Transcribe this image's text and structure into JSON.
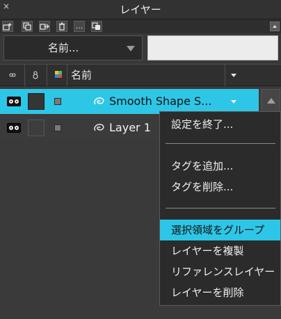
{
  "panel": {
    "title": "レイヤー"
  },
  "toolbar": {
    "buttons": [
      "new-layer-icon",
      "duplicate-icon",
      "export-icon",
      "trash-icon",
      "more-icon",
      "merge-icon"
    ],
    "more_label": "..."
  },
  "filter": {
    "sort_label": "名前...",
    "search_value": "",
    "search_placeholder": ""
  },
  "columns": {
    "name": "名前"
  },
  "layers": [
    {
      "name": "Smooth Shape S...",
      "selected": true
    },
    {
      "name": "Layer 1",
      "selected": false
    }
  ],
  "context_menu": {
    "items": [
      {
        "label": "設定を終了..."
      },
      {
        "label": "タグを追加..."
      },
      {
        "label": "タグを削除..."
      },
      {
        "label": "選択領域をグループ",
        "highlighted": true
      },
      {
        "label": "レイヤーを複製"
      },
      {
        "label": "リファレンスレイヤー"
      },
      {
        "label": "レイヤーを削除"
      }
    ]
  },
  "colors": {
    "accent": "#2ec6e6",
    "panel_bg": "#3a3a3a",
    "menu_bg": "#2b2b2b"
  }
}
